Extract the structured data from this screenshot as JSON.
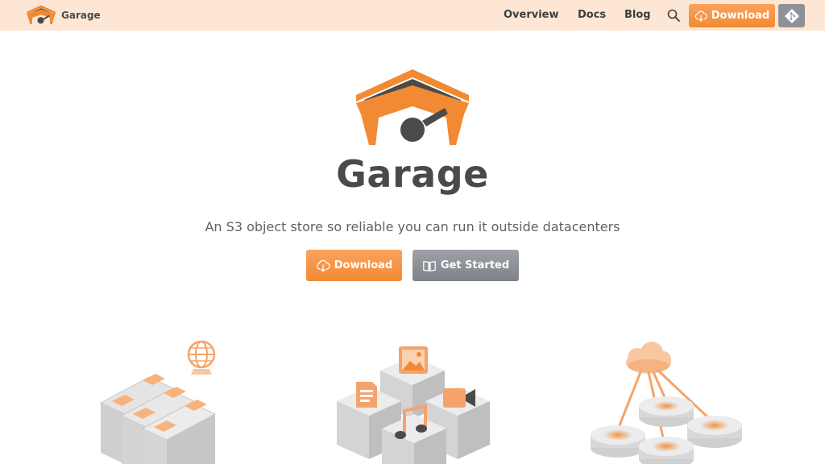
{
  "brand": {
    "name": "Garage",
    "logo_icon": "garage-logo-icon"
  },
  "nav": {
    "links": [
      "Overview",
      "Docs",
      "Blog"
    ],
    "search_icon": "search-icon",
    "download_label": "Download",
    "download_icon": "cloud-download-icon",
    "git_icon": "git-icon"
  },
  "hero": {
    "title": "Garage",
    "tagline": "An S3 object store so reliable you can run it outside datacenters",
    "download_label": "Download",
    "get_started_label": "Get Started",
    "book_icon": "book-open-icon"
  },
  "features": {
    "icons": [
      "server-rack-illustration",
      "object-cubes-illustration",
      "cloud-storage-illustration"
    ]
  },
  "colors": {
    "accent": "#f28a33",
    "nav_bg": "#fde7d4",
    "secondary_button": "#8e9198",
    "text": "#4a4a4a"
  }
}
